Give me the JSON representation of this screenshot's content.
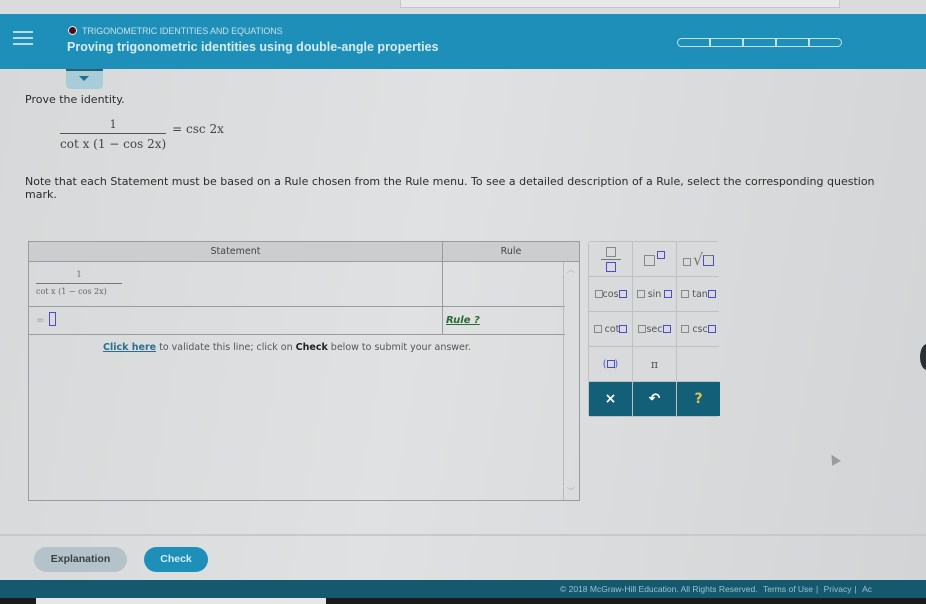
{
  "header": {
    "topic": "TRIGONOMETRIC IDENTITIES AND EQUATIONS",
    "title": "Proving trigonometric identities using double-angle properties",
    "progress_segments_total": 5,
    "progress_segments_filled": 0
  },
  "problem": {
    "prompt": "Prove the identity.",
    "identity_numerator": "1",
    "identity_denominator": "cot x (1 − cos 2x)",
    "identity_rhs": "= csc 2x",
    "note": "Note that each Statement must be based on a Rule chosen from the Rule menu. To see a detailed description of a Rule, select the corresponding question mark."
  },
  "table": {
    "headers": {
      "statement": "Statement",
      "rule": "Rule"
    },
    "rows": [
      {
        "statement_numerator": "1",
        "statement_denominator": "cot x (1 − cos 2x)",
        "rule": ""
      },
      {
        "statement_prefix": "=",
        "statement_value": "",
        "rule": "Rule ?"
      }
    ],
    "validate": {
      "link": "Click here",
      "text1": " to validate this line; click on ",
      "bold": "Check",
      "text2": " below to submit your answer."
    }
  },
  "palette": {
    "row2": [
      "cos",
      "sin",
      "tan"
    ],
    "row3": [
      "cot",
      "sec",
      "csc"
    ],
    "pi": "π",
    "actions": {
      "clear": "×",
      "undo": "↶",
      "help": "?"
    }
  },
  "buttons": {
    "explanation": "Explanation",
    "check": "Check"
  },
  "footer": {
    "copyright": "© 2018 McGraw-Hill Education. All Rights Reserved.",
    "terms": "Terms of Use",
    "privacy": "Privacy",
    "accessibility": "Ac"
  }
}
